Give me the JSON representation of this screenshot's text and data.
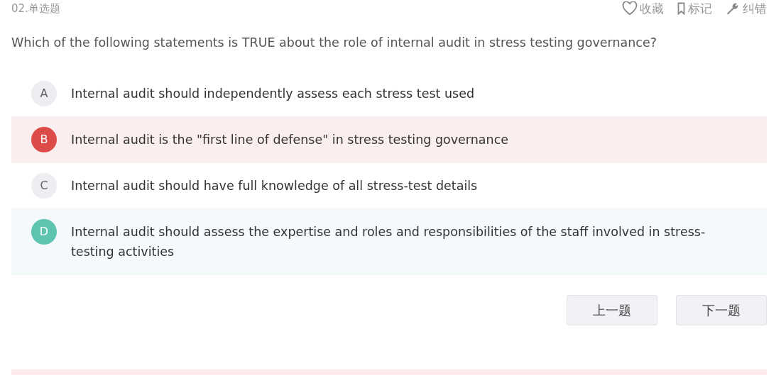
{
  "header": {
    "number": "02.单选题",
    "actions": [
      {
        "kind": "favorite",
        "label": "收藏"
      },
      {
        "kind": "bookmark",
        "label": "标记"
      },
      {
        "kind": "report",
        "label": "纠错"
      }
    ]
  },
  "question": "Which of the following statements is TRUE about the role of internal audit in stress testing governance?",
  "options": [
    {
      "letter": "A",
      "text": "Internal audit should independently assess each stress test used",
      "selected": false,
      "correct": false
    },
    {
      "letter": "B",
      "text": "Internal audit is the \"first line of defense\" in stress testing governance",
      "selected": true,
      "correct": false
    },
    {
      "letter": "C",
      "text": "Internal audit should have full knowledge of all stress-test details",
      "selected": false,
      "correct": false
    },
    {
      "letter": "D",
      "text": "Internal audit should assess the expertise and roles and responsibilities of the staff involved in stress-testing activities",
      "selected": false,
      "correct": true
    }
  ],
  "buttons": [
    "上一题",
    "下一题"
  ]
}
